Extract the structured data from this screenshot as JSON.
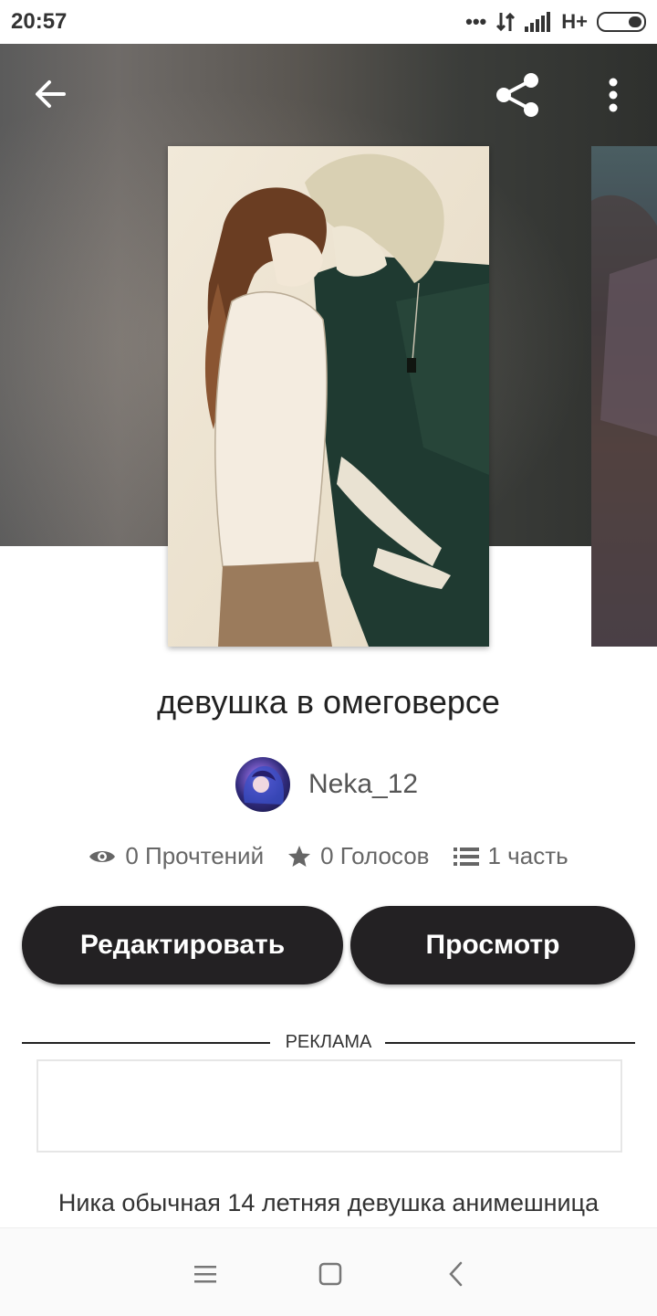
{
  "status_bar": {
    "time": "20:57",
    "network": "H+",
    "icons": [
      "dots-icon",
      "data-arrows-icon",
      "signal-icon",
      "battery-icon"
    ]
  },
  "toolbar": {
    "back_icon": "arrow-left-icon",
    "share_icon": "share-icon",
    "more_icon": "more-vertical-icon"
  },
  "story": {
    "title": "девушка в омеговерсе",
    "author": "Neka_12",
    "stats": {
      "reads": "0 Прочтений",
      "votes": "0 Голосов",
      "parts": "1 часть"
    },
    "description": "Ника обычная 14 летняя девушка анимешница"
  },
  "actions": {
    "edit_label": "Редактировать",
    "view_label": "Просмотр"
  },
  "ad": {
    "label": "РЕКЛАМА"
  },
  "nav": {
    "icons": [
      "menu-icon",
      "home-square-icon",
      "back-chevron-icon"
    ]
  }
}
